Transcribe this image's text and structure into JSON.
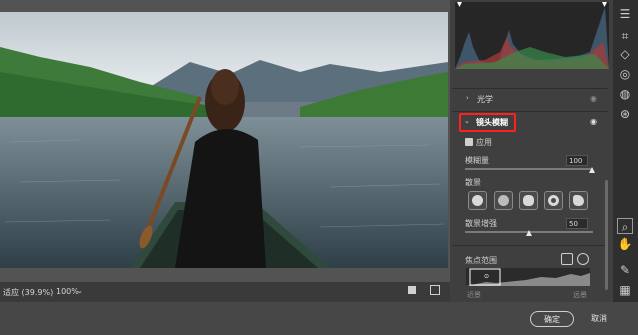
{
  "panel": {
    "section_light": "光学",
    "section_lens_blur": "镜头模糊",
    "apply_label": "应用",
    "blur_amount_label": "模糊量",
    "blur_amount_value": "100",
    "blur_amount_fraction": 1.0,
    "bokeh_label": "散景",
    "bokeh_boost_label": "散景增强",
    "bokeh_boost_value": "50",
    "bokeh_boost_fraction": 0.5,
    "focus_range_label": "焦点范围",
    "near_label": "近景",
    "far_label": "远景"
  },
  "status": {
    "fit_label": "适应 (39.9%)",
    "zoom_label": "100%",
    "zoom_chevron": "chevron-down-icon"
  },
  "footer": {
    "ok_label": "确定",
    "cancel_label": "取消"
  },
  "toolbar_icons": [
    "sliders-icon",
    "crop-icon",
    "eraser-icon",
    "redeye-icon",
    "mask-icon",
    "presets-icon",
    "zoom-icon",
    "hand-icon",
    "eyedropper-icon",
    "grid-icon"
  ],
  "colors": {
    "highlight_box": "#ff2020",
    "accent": "#e8e8e8"
  }
}
